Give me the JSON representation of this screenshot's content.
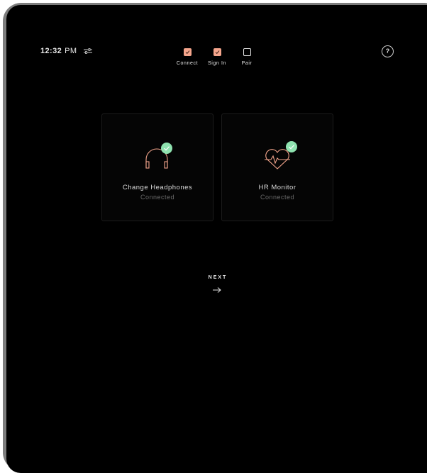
{
  "status_bar": {
    "time": "12:32",
    "ampm": "PM"
  },
  "steps": [
    {
      "label": "Connect",
      "state": "done"
    },
    {
      "label": "Sign In",
      "state": "done"
    },
    {
      "label": "Pair",
      "state": "pending"
    }
  ],
  "help": {
    "label": "?"
  },
  "devices": [
    {
      "name": "Change Headphones",
      "status": "Connected",
      "icon": "headphones-icon"
    },
    {
      "name": "HR Monitor",
      "status": "Connected",
      "icon": "heart-rate-icon"
    }
  ],
  "next": {
    "label": "NEXT"
  },
  "colors": {
    "accent": "#f4a58c",
    "check_badge": "#8fe3b0",
    "background": "#000000",
    "card_border": "#1b1b1b",
    "muted_text": "#6a6a6a"
  }
}
